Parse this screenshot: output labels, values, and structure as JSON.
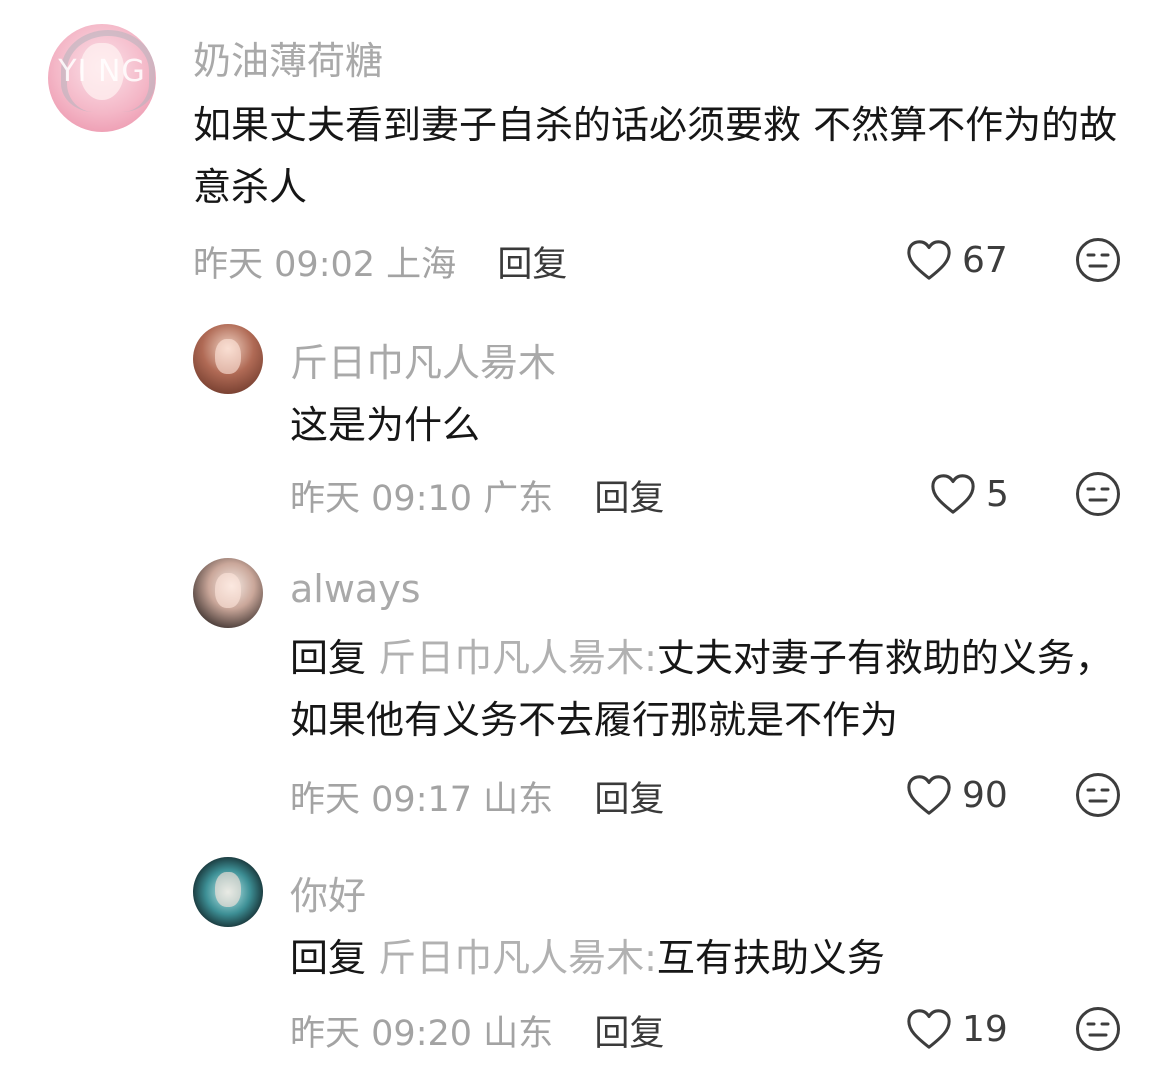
{
  "comments": [
    {
      "user": "奶油薄荷糖",
      "avatar_text": "YI NG",
      "text": "如果丈夫看到妻子自杀的话必须要救 不然算不作为的故意杀人",
      "date": "昨天",
      "time": "09:02",
      "location": "上海",
      "reply_label": "回复",
      "likes": "67"
    },
    {
      "user": "斤日巾凡人昜木",
      "text": "这是为什么",
      "date": "昨天",
      "time": "09:10",
      "location": "广东",
      "reply_label": "回复",
      "likes": "5"
    },
    {
      "user": "always",
      "reply_prefix": "回复",
      "reply_target": "斤日巾凡人昜木:",
      "text": "丈夫对妻子有救助的义务，如果他有义务不去履行那就是不作为",
      "date": "昨天",
      "time": "09:17",
      "location": "山东",
      "reply_label": "回复",
      "likes": "90"
    },
    {
      "user": "你好",
      "reply_prefix": "回复",
      "reply_target": "斤日巾凡人昜木:",
      "text": "互有扶助义务",
      "date": "昨天",
      "time": "09:20",
      "location": "山东",
      "reply_label": "回复",
      "likes": "19"
    }
  ],
  "icons": {
    "like": "heart-outline-icon",
    "dislike": "meh-face-icon"
  },
  "colors": {
    "username": "#a9a9a9",
    "text": "#161616",
    "meta": "#a3a3a3"
  }
}
